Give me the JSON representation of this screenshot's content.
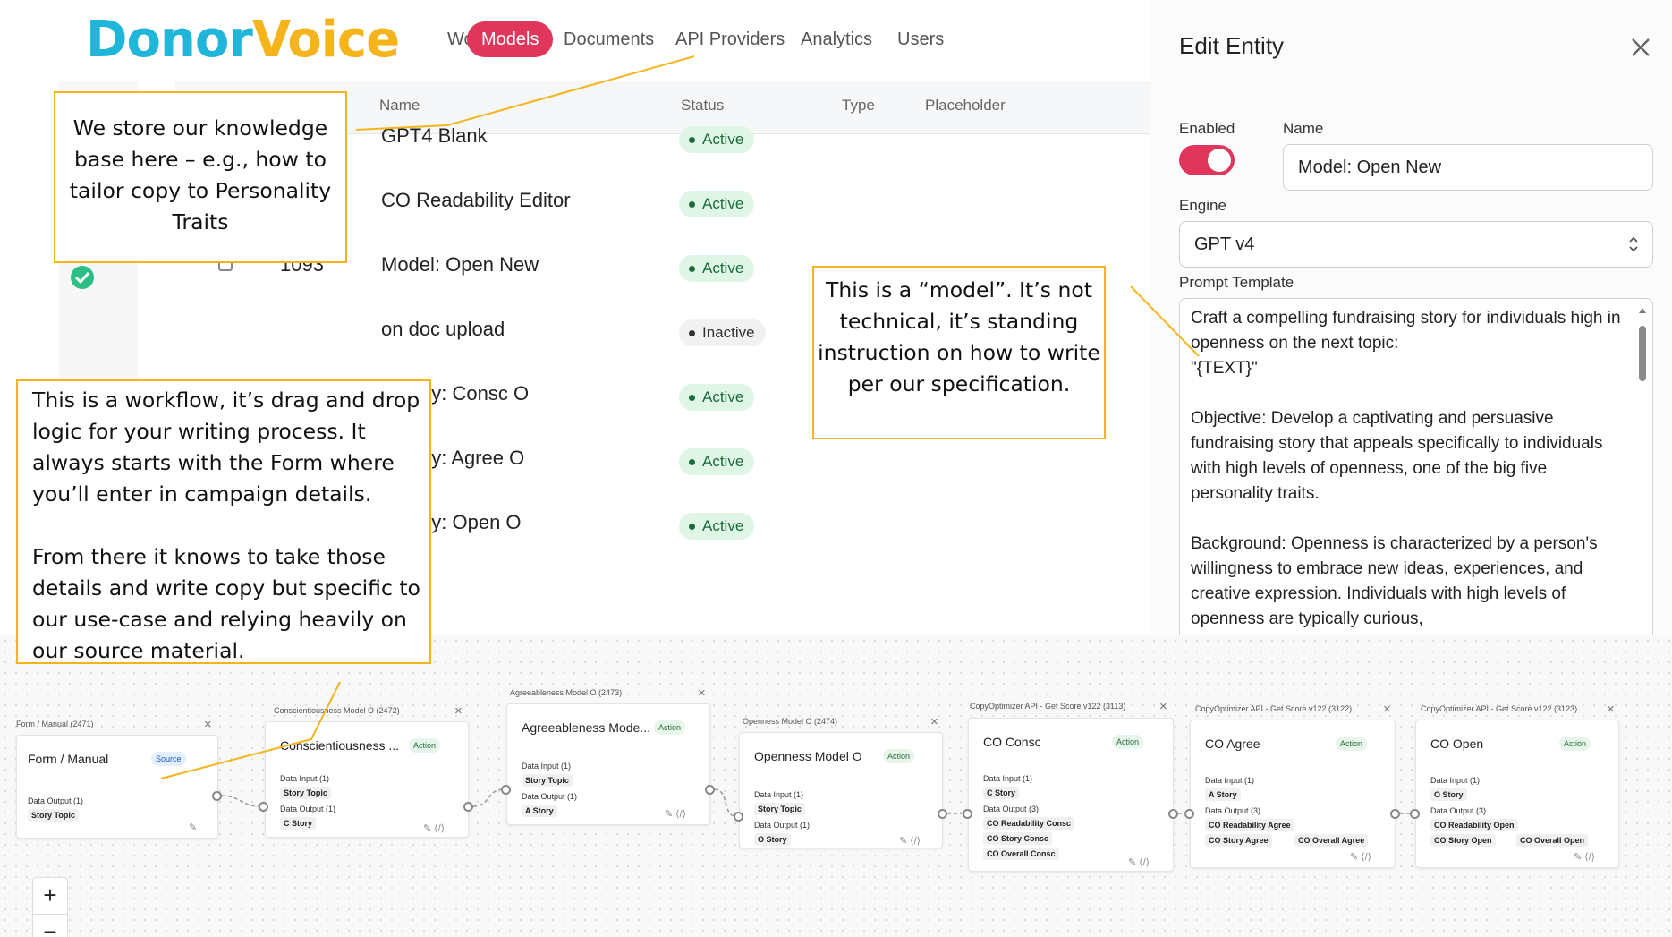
{
  "brand": {
    "part1": "Donor",
    "part2": "Voice"
  },
  "nav": [
    "Workflows",
    "Models",
    "Documents",
    "API Providers",
    "Analytics",
    "Users"
  ],
  "table": {
    "headers": {
      "name": "Name",
      "status": "Status",
      "type": "Type",
      "placeholder": "Placeholder"
    },
    "rows": [
      {
        "id": "",
        "name": "GPT4 Blank",
        "status": "Active"
      },
      {
        "id": "",
        "name": "CO Readability Editor",
        "status": "Active"
      },
      {
        "id": "1093",
        "name": "Model: Open New",
        "status": "Active"
      },
      {
        "id": "",
        "name": "on doc upload",
        "status": "Inactive"
      },
      {
        "id": "",
        "name": "s Body: Consc O",
        "status": "Active"
      },
      {
        "id": "",
        "name": "s Body: Agree O",
        "status": "Active"
      },
      {
        "id": "",
        "name": "s Body: Open O",
        "status": "Active"
      }
    ]
  },
  "edit_panel": {
    "title": "Edit Entity",
    "enabled_label": "Enabled",
    "enabled": true,
    "name_label": "Name",
    "name_value": "Model: Open New",
    "engine_label": "Engine",
    "engine_value": "GPT v4",
    "prompt_label": "Prompt Template",
    "prompt_text": "Craft a compelling fundraising story for individuals high in openness on the next topic:\n\"{TEXT}\"\n\nObjective: Develop a captivating and persuasive fundraising story that appeals specifically to individuals with high levels of openness, one of the big five personality traits.\n\nBackground: Openness is characterized by a person's willingness to embrace new ideas, experiences, and creative expression. Individuals with high levels of openness are typically curious,"
  },
  "callouts": {
    "knowledge_base": "We store our knowledge base here – e.g., how to tailor copy to Personality Traits",
    "model": "This is a “model”.  It’s not technical, it’s standing instruction on how to write per our specification.",
    "workflow_p1": "This is a workflow, it’s drag and drop logic for your writing process.  It always starts with the Form where you’ll enter in campaign details.",
    "workflow_p2": "From there it knows to take those details and write copy but specific to our use-case and relying heavily on our source material."
  },
  "workflow_nodes": [
    {
      "caption": "Form / Manual (2471)",
      "title": "Form / Manual",
      "tag": "Source",
      "sections": [
        {
          "label": "Data Output (1)",
          "chips": [
            "Story Topic"
          ]
        }
      ]
    },
    {
      "caption": "Conscientiousness Model O (2472)",
      "title": "Conscientiousness ...",
      "tag": "Action",
      "sections": [
        {
          "label": "Data Input (1)",
          "chips": [
            "Story Topic"
          ]
        },
        {
          "label": "Data Output (1)",
          "chips": [
            "C Story"
          ]
        }
      ]
    },
    {
      "caption": "Agreeableness Model O (2473)",
      "title": "Agreeableness Mode...",
      "tag": "Action",
      "sections": [
        {
          "label": "Data Input (1)",
          "chips": [
            "Story Topic"
          ]
        },
        {
          "label": "Data Output (1)",
          "chips": [
            "A Story"
          ]
        }
      ]
    },
    {
      "caption": "Openness Model O (2474)",
      "title": "Openness Model O",
      "tag": "Action",
      "sections": [
        {
          "label": "Data Input (1)",
          "chips": [
            "Story Topic"
          ]
        },
        {
          "label": "Data Output (1)",
          "chips": [
            "O Story"
          ]
        }
      ]
    },
    {
      "caption": "CopyOptimizer API - Get Score v122 (3113)",
      "title": "CO Consc",
      "tag": "Action",
      "sections": [
        {
          "label": "Data Input (1)",
          "chips": [
            "C Story"
          ]
        },
        {
          "label": "Data Output (3)",
          "chips": [
            "CO Readability Consc",
            "CO Story Consc",
            "CO Overall Consc"
          ]
        }
      ]
    },
    {
      "caption": "CopyOptimizer API - Get Score v122 (3122)",
      "title": "CO Agree",
      "tag": "Action",
      "sections": [
        {
          "label": "Data Input (1)",
          "chips": [
            "A Story"
          ]
        },
        {
          "label": "Data Output (3)",
          "chips": [
            "CO Readability Agree",
            "CO Story Agree",
            "CO Overall Agree"
          ]
        }
      ]
    },
    {
      "caption": "CopyOptimizer API - Get Score v122 (3123)",
      "title": "CO Open",
      "tag": "Action",
      "sections": [
        {
          "label": "Data Input (1)",
          "chips": [
            "O Story"
          ]
        },
        {
          "label": "Data Output (3)",
          "chips": [
            "CO Readability Open",
            "CO Story Open",
            "CO Overall Open"
          ]
        }
      ]
    }
  ],
  "zoom": {
    "in": "+",
    "out": "−"
  },
  "colors": {
    "accent": "#e0365b",
    "brand_blue": "#1fb6d9",
    "brand_gold": "#f5b41c",
    "active_badge": "#dff5e6"
  }
}
